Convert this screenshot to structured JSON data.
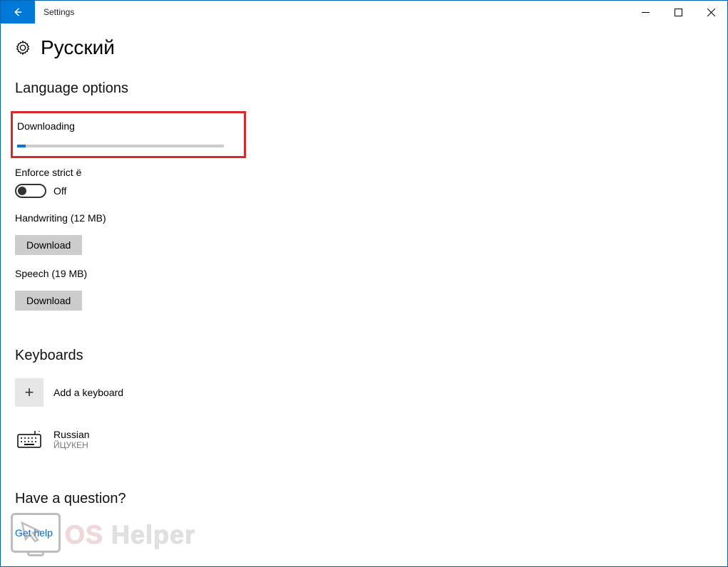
{
  "window": {
    "title": "Settings"
  },
  "page": {
    "title": "Русский"
  },
  "language_options": {
    "heading": "Language options",
    "downloading": "Downloading",
    "progress_percent": 4,
    "enforce_label": "Enforce strict ё",
    "toggle_state": "Off",
    "handwriting_label": "Handwriting (12 MB)",
    "handwriting_btn": "Download",
    "speech_label": "Speech (19 MB)",
    "speech_btn": "Download"
  },
  "keyboards": {
    "heading": "Keyboards",
    "add_label": "Add a keyboard",
    "items": [
      {
        "name": "Russian",
        "layout": "ЙЦУКЕН"
      }
    ]
  },
  "help": {
    "heading": "Have a question?",
    "link": "Get help"
  },
  "watermark": {
    "text1": "OS",
    "text2": "Helper"
  }
}
